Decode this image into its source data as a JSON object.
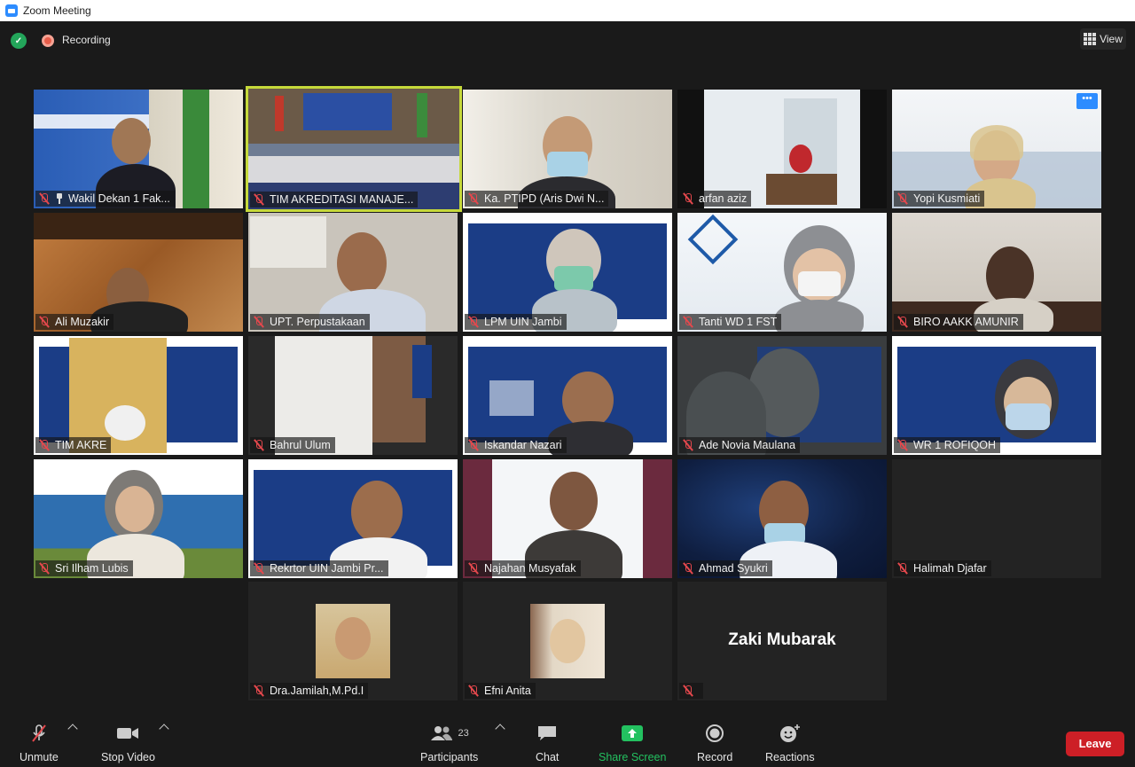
{
  "window": {
    "title": "Zoom Meeting"
  },
  "topbar": {
    "recording_label": "Recording",
    "view_label": "View"
  },
  "participants": [
    {
      "name": "Wakil Dekan 1 Fak..."
    },
    {
      "name": "TIM AKREDITASI MANAJE..."
    },
    {
      "name": "Ka. PTIPD (Aris Dwi N..."
    },
    {
      "name": "arfan aziz"
    },
    {
      "name": "Yopi Kusmiati"
    },
    {
      "name": "Ali Muzakir"
    },
    {
      "name": "UPT. Perpustakaan"
    },
    {
      "name": "LPM UIN Jambi"
    },
    {
      "name": "Tanti WD 1 FST"
    },
    {
      "name": "BIRO AAKK AMUNIR"
    },
    {
      "name": "TIM AKRE"
    },
    {
      "name": "Bahrul Ulum"
    },
    {
      "name": "Iskandar Nazari"
    },
    {
      "name": "Ade Novia Maulana"
    },
    {
      "name": "WR 1 ROFIQOH"
    },
    {
      "name": "Sri Ilham Lubis"
    },
    {
      "name": "Rekrtor UIN Jambi Pr..."
    },
    {
      "name": "Najahan Musyafak"
    },
    {
      "name": "Ahmad Syukri"
    },
    {
      "name": "Halimah Djafar"
    },
    {
      "name": "Dra.Jamilah,M.Pd.I"
    },
    {
      "name": "Efni Anita"
    },
    {
      "name": "",
      "display_name": "Zaki Mubarak"
    }
  ],
  "toolbar": {
    "unmute": "Unmute",
    "stop_video": "Stop Video",
    "participants": "Participants",
    "participants_count": "23",
    "chat": "Chat",
    "share_screen": "Share Screen",
    "record": "Record",
    "reactions": "Reactions",
    "leave": "Leave"
  },
  "colors": {
    "active_speaker_border": "#c6d93a",
    "leave": "#cd1f26",
    "share_screen": "#23c160",
    "muted": "#e5484d"
  }
}
